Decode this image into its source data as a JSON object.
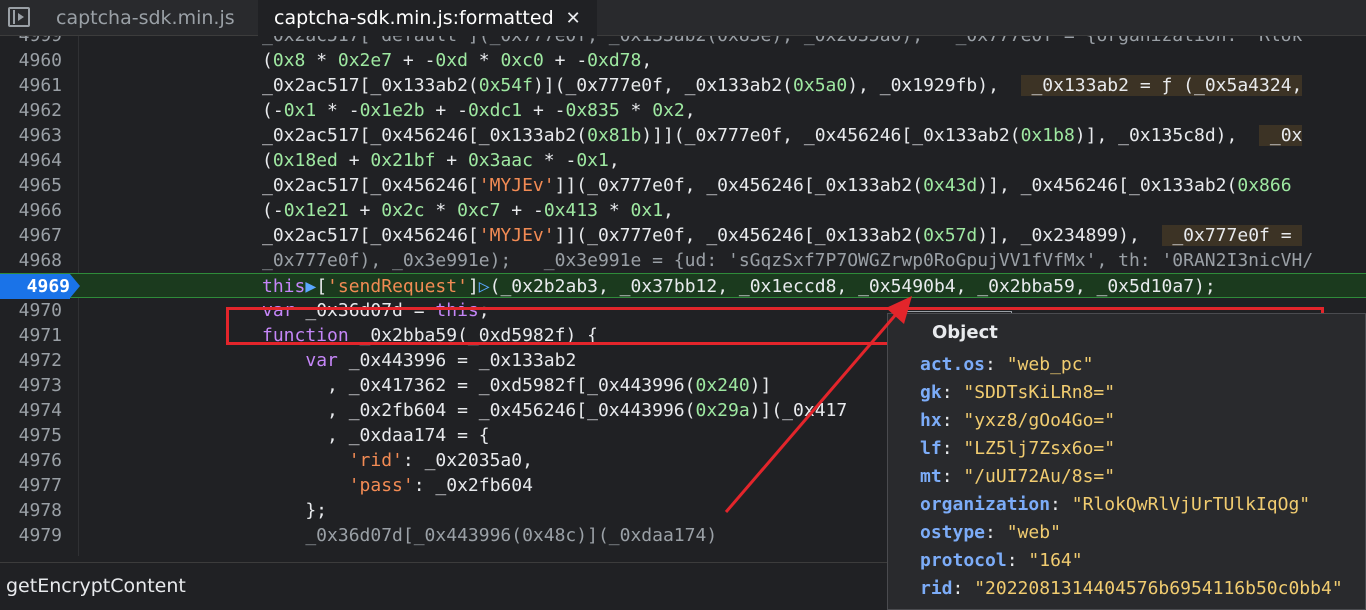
{
  "tabs": [
    {
      "label": "captcha-sdk.min.js"
    },
    {
      "label": "captcha-sdk.min.js:formatted",
      "close": "✕"
    }
  ],
  "editor": {
    "lines": [
      {
        "num": "4999",
        "parts": [
          [
            "partial",
            "_0x2ac517['default'](_0x777e0f, _0x133ab2(0x83e), _0x2035a0);   _0x777e0f = {organization: 'Rlok"
          ]
        ]
      },
      {
        "num": "4960",
        "parts": [
          [
            "",
            "("
          ],
          [
            "num",
            "0x8"
          ],
          [
            "",
            " * "
          ],
          [
            "num",
            "0x2e7"
          ],
          [
            "",
            " + -"
          ],
          [
            "num",
            "0xd"
          ],
          [
            "",
            " * "
          ],
          [
            "num",
            "0xc0"
          ],
          [
            "",
            " + -"
          ],
          [
            "num",
            "0xd78"
          ],
          [
            "",
            ","
          ]
        ]
      },
      {
        "num": "4961",
        "parts": [
          [
            "",
            "_0x2ac517[_0x133ab2("
          ],
          [
            "num",
            "0x54f"
          ],
          [
            "",
            ")](_0x777e0f, _0x133ab2("
          ],
          [
            "num",
            "0x5a0"
          ],
          [
            "",
            "), _0x1929fb),  "
          ],
          [
            "hl",
            " _0x133ab2 = ƒ (_0x5a4324,"
          ]
        ]
      },
      {
        "num": "4962",
        "parts": [
          [
            "",
            "(-"
          ],
          [
            "num",
            "0x1"
          ],
          [
            "",
            " * -"
          ],
          [
            "num",
            "0x1e2b"
          ],
          [
            "",
            " + -"
          ],
          [
            "num",
            "0xdc1"
          ],
          [
            "",
            " + -"
          ],
          [
            "num",
            "0x835"
          ],
          [
            "",
            " * "
          ],
          [
            "num",
            "0x2"
          ],
          [
            "",
            ","
          ]
        ]
      },
      {
        "num": "4963",
        "parts": [
          [
            "",
            "_0x2ac517[_0x456246[_0x133ab2("
          ],
          [
            "num",
            "0x81b"
          ],
          [
            "",
            ")]](_0x777e0f, _0x456246[_0x133ab2("
          ],
          [
            "num",
            "0x1b8"
          ],
          [
            "",
            ")], _0x135c8d),  "
          ],
          [
            "hl",
            " _0x"
          ]
        ]
      },
      {
        "num": "4964",
        "parts": [
          [
            "",
            "("
          ],
          [
            "num",
            "0x18ed"
          ],
          [
            "",
            " + "
          ],
          [
            "num",
            "0x21bf"
          ],
          [
            "",
            " + "
          ],
          [
            "num",
            "0x3aac"
          ],
          [
            "",
            " * -"
          ],
          [
            "num",
            "0x1"
          ],
          [
            "",
            ","
          ]
        ]
      },
      {
        "num": "4965",
        "parts": [
          [
            "",
            "_0x2ac517[_0x456246["
          ],
          [
            "str",
            "'MYJEv'"
          ],
          [
            "",
            "]](_0x777e0f, _0x456246[_0x133ab2("
          ],
          [
            "num",
            "0x43d"
          ],
          [
            "",
            ")], _0x456246[_0x133ab2("
          ],
          [
            "num",
            "0x866"
          ]
        ]
      },
      {
        "num": "4966",
        "parts": [
          [
            "",
            "(-"
          ],
          [
            "num",
            "0x1e21"
          ],
          [
            "",
            " + "
          ],
          [
            "num",
            "0x2c"
          ],
          [
            "",
            " * "
          ],
          [
            "num",
            "0xc7"
          ],
          [
            "",
            " + -"
          ],
          [
            "num",
            "0x413"
          ],
          [
            "",
            " * "
          ],
          [
            "num",
            "0x1"
          ],
          [
            "",
            ","
          ]
        ]
      },
      {
        "num": "4967",
        "parts": [
          [
            "",
            "_0x2ac517[_0x456246["
          ],
          [
            "str",
            "'MYJEv'"
          ],
          [
            "",
            "]](_0x777e0f, _0x456246[_0x133ab2("
          ],
          [
            "num",
            "0x57d"
          ],
          [
            "",
            ")], _0x234899),  "
          ],
          [
            "hl",
            " _0x777e0f = "
          ]
        ]
      },
      {
        "num": "4968",
        "parts": [
          [
            "partial",
            "_0x777e0f), _0x3e991e);   _0x3e991e = {ud: 'sGqzSxf7P7OWGZrwp0RoGpujVV1fVfMx', th: '0RAN2I3nicVH/"
          ]
        ]
      },
      {
        "num": "4969",
        "current": true,
        "parts": [
          [
            "kw",
            "this"
          ],
          [
            "chev",
            "▶"
          ],
          [
            "",
            "["
          ],
          [
            "str",
            "'sendRequest'"
          ],
          [
            "",
            "]"
          ],
          [
            "chev",
            "▷"
          ],
          [
            "",
            "(_0x2b2ab3, _0x37bb12, _0x1eccd8, _0x5490b4, _0x2bba59, _0x5d10a7);"
          ]
        ]
      },
      {
        "num": "4970",
        "parts": [
          [
            "kw",
            "var"
          ],
          [
            "",
            " _0x36d07d = "
          ],
          [
            "kw",
            "this"
          ],
          [
            "",
            ";"
          ]
        ]
      },
      {
        "num": "4971",
        "parts": [
          [
            "kw",
            "function"
          ],
          [
            "",
            " _0x2bba59(_0xd5982f) {"
          ]
        ]
      },
      {
        "num": "4972",
        "parts": [
          [
            "",
            "    "
          ],
          [
            "kw",
            "var"
          ],
          [
            "",
            " _0x443996 = _0x133ab2"
          ]
        ]
      },
      {
        "num": "4973",
        "parts": [
          [
            "",
            "      , _0x417362 = _0xd5982f[_0x443996("
          ],
          [
            "num",
            "0x240"
          ],
          [
            "",
            ")]"
          ]
        ]
      },
      {
        "num": "4974",
        "parts": [
          [
            "",
            "      , _0x2fb604 = _0x456246[_0x443996("
          ],
          [
            "num",
            "0x29a"
          ],
          [
            "",
            ")](_0x417"
          ]
        ]
      },
      {
        "num": "4975",
        "parts": [
          [
            "",
            "      , _0xdaa174 = {"
          ]
        ]
      },
      {
        "num": "4976",
        "parts": [
          [
            "",
            "        "
          ],
          [
            "str",
            "'rid'"
          ],
          [
            "",
            ": _0x2035a0,"
          ]
        ]
      },
      {
        "num": "4977",
        "parts": [
          [
            "",
            "        "
          ],
          [
            "str",
            "'pass'"
          ],
          [
            "",
            ": _0x2fb604"
          ]
        ]
      },
      {
        "num": "4978",
        "parts": [
          [
            "",
            "    };"
          ]
        ]
      },
      {
        "num": "4979",
        "parts": [
          [
            "partial",
            "    _0x36d07d[_0x443996(0x48c)](_0xdaa174)"
          ]
        ]
      }
    ]
  },
  "status": {
    "function_name": "getEncryptContent"
  },
  "popover": {
    "title": "Object",
    "props": [
      {
        "key": "act.os",
        "value": "\"web_pc\""
      },
      {
        "key": "gk",
        "value": "\"SDDTsKiLRn8=\""
      },
      {
        "key": "hx",
        "value": "\"yxz8/gOo4Go=\""
      },
      {
        "key": "lf",
        "value": "\"LZ5lj7Zsx6o=\""
      },
      {
        "key": "mt",
        "value": "\"/uUI72Au/8s=\""
      },
      {
        "key": "organization",
        "value": "\"RlokQwRlVjUrTUlkIqOg\""
      },
      {
        "key": "ostype",
        "value": "\"web\""
      },
      {
        "key": "protocol",
        "value": "\"164\""
      },
      {
        "key": "rid",
        "value": "\"2022081314404576b6954116b50c0bb4\""
      }
    ]
  },
  "colors": {
    "annotation": "#e3252b",
    "current_line": "#1a73e8"
  },
  "icons": {
    "panel_toggle": "panel-toggle-icon",
    "close": "close-icon"
  }
}
